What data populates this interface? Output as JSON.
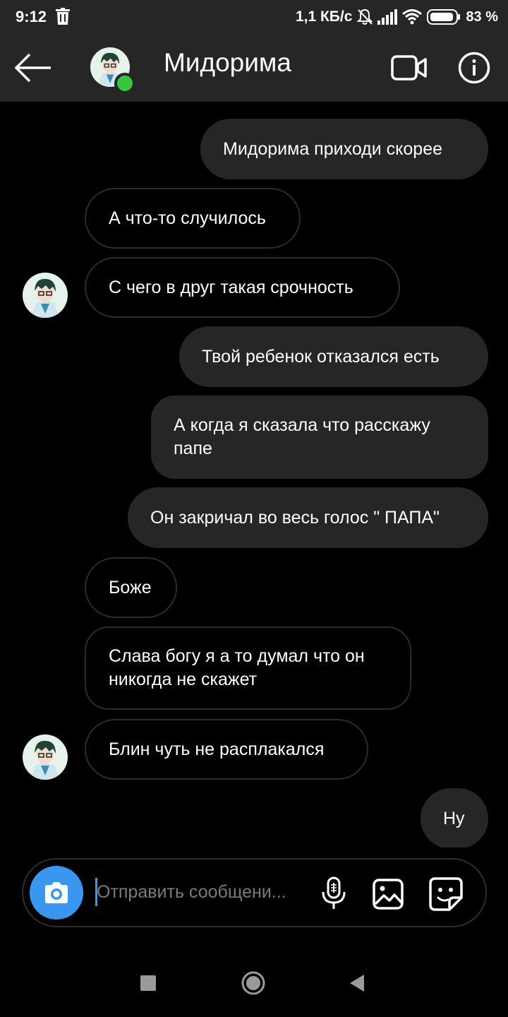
{
  "status_bar": {
    "time": "9:12",
    "speed": "1,1 КБ/с",
    "battery": "83 %",
    "icons": [
      "trash-icon",
      "mute-bell-icon",
      "signal-icon",
      "wifi-icon",
      "battery-icon"
    ]
  },
  "header": {
    "contact_name": "Мидорима",
    "online": true,
    "icons": [
      "back-arrow-icon",
      "video-call-icon",
      "info-icon"
    ]
  },
  "messages": [
    {
      "direction": "out",
      "text": "Мидорима приходи скорее"
    },
    {
      "direction": "in",
      "text": "А что-то случилось"
    },
    {
      "direction": "in",
      "text": "С чего в друг такая срочность"
    },
    {
      "direction": "out",
      "text": "Твой ребенок отказался есть"
    },
    {
      "direction": "out",
      "text_lines": [
        "А когда я сказала что расскажу",
        "папе"
      ]
    },
    {
      "direction": "out",
      "text": "Он закричал во весь голос \" ПАПА\""
    },
    {
      "direction": "in",
      "text": "Боже"
    },
    {
      "direction": "in",
      "text_lines": [
        "Слава богу я а то думал что он",
        "никогда не скажет"
      ]
    },
    {
      "direction": "in",
      "text": "Блин чуть не расплакался"
    },
    {
      "direction": "out",
      "text": "Ну"
    }
  ],
  "composer": {
    "placeholder": "Отправить сообщени...",
    "value": "",
    "icons": [
      "camera-icon",
      "microphone-icon",
      "gallery-icon",
      "sticker-icon"
    ]
  },
  "colors": {
    "background": "#000000",
    "bar": "#262626",
    "outgoing_bubble": "#262626",
    "accent": "#3897f0",
    "online": "#37c53a"
  }
}
